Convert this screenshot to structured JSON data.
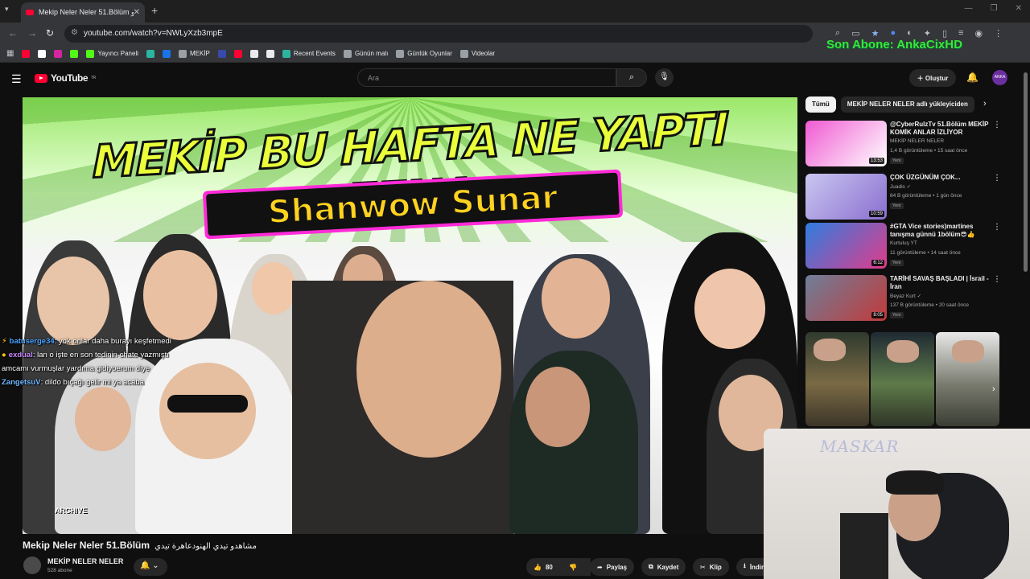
{
  "browser": {
    "tab_title": "Mekip Neler Neler 51.Bölüm مشاهدو",
    "tab_close": "✕",
    "new_tab": "+",
    "url": "youtube.com/watch?v=NWLyXzb3mpE",
    "bookmarks": [
      {
        "label": "",
        "color": "#ff0033"
      },
      {
        "label": "",
        "color": "#ffffff"
      },
      {
        "label": "",
        "color": "#d6249f"
      },
      {
        "label": "",
        "color": "#53fc18"
      },
      {
        "label": "Yayıncı Paneli",
        "color": "#53fc18"
      },
      {
        "label": "",
        "color": "#2bb5a0"
      },
      {
        "label": "",
        "color": "#1a73e8"
      },
      {
        "label": "MEKİP",
        "color": "#9aa0a6"
      },
      {
        "label": "",
        "color": "#3949ab"
      },
      {
        "label": "",
        "color": "#ff0033"
      },
      {
        "label": "",
        "color": "#e8eaed"
      },
      {
        "label": "",
        "color": "#e8eaed"
      },
      {
        "label": "Recent Events",
        "color": "#2bb5a0"
      },
      {
        "label": "Günün malı",
        "color": "#9aa0a6"
      },
      {
        "label": "Günlük Oyunlar",
        "color": "#9aa0a6"
      },
      {
        "label": "Videolar",
        "color": "#9aa0a6"
      }
    ]
  },
  "overlay": {
    "last_sub": "Son Abone: AnkaCixHD"
  },
  "youtube": {
    "logo_text": "YouTube",
    "logo_region": "TR",
    "search_placeholder": "Ara",
    "create_label": "Oluştur",
    "avatar_text": "ANKA"
  },
  "thumbnail": {
    "headline": "MEKİP BU HAFTA NE YAPTI FENA",
    "subheadline": "Shanwow Sunar",
    "watermark": "ARCHIVE"
  },
  "chat": [
    {
      "user": "batuserge34",
      "text": ": yok onlar daha burayı keşfetmedi",
      "color": "#4aa3ff",
      "badge": "⚡"
    },
    {
      "user": "exdual",
      "text": ": lan o işte en son tedinin chate yazmıştı",
      "color": "#c78bff",
      "badge": "●"
    },
    {
      "user": "",
      "text": "amcamı vurmuşlar yardıma gidiyoerum diye",
      "color": "#ffffff",
      "badge": ""
    },
    {
      "user": "ZangetsuV",
      "text": ": dildo bıçağı gelir mi ya acaba",
      "color": "#6fb7ff",
      "badge": ""
    }
  ],
  "webcam": {
    "name": "MASKAR"
  },
  "video": {
    "title": "Mekip Neler Neler 51.Bölüm",
    "title_ar": "مشاهدو تيدي الهنودعاهرة تيدي",
    "channel": "MEKİP NELER NELER",
    "subscribers": "528 abone",
    "likes": "80",
    "share": "Paylaş",
    "save": "Kaydet",
    "clip": "Klip",
    "download": "İndir"
  },
  "chips": [
    "Tümü",
    "MEKİP NELER NELER adlı yükleyiciden"
  ],
  "recommendations": [
    {
      "title": "@CyberRulzTv 51.Bölüm MEKİP KOMİK ANLAR İZLİYOR",
      "channel": "MEKİP NELER NELER",
      "meta": "1,4 B görüntüleme • 15 saat önce",
      "badge": "Yeni",
      "duration": "13:53",
      "thumb": [
        "#f05ad2",
        "#ffffff"
      ]
    },
    {
      "title": "ÇOK ÜZGÜNÜM ÇOK...",
      "channel": "Juadis ✓",
      "meta": "84 B görüntüleme • 1 gün önce",
      "badge": "Yeni",
      "duration": "10:59",
      "thumb": [
        "#c9c6f0",
        "#8a6fd0"
      ]
    },
    {
      "title": "#GTA Vice stories)martines tanışma günnü 1bölüm😎👍",
      "channel": "Kurtuluş YT",
      "meta": "11 görüntüleme • 14 saat önce",
      "badge": "Yeni",
      "duration": "6:12",
      "thumb": [
        "#2f7de0",
        "#e03c8a"
      ]
    },
    {
      "title": "TARİHİ SAVAŞ BAŞLADI | İsrail - İran",
      "channel": "Beyaz Kurt ✓",
      "meta": "137 B görüntüleme • 20 saat önce",
      "badge": "Yeni",
      "duration": "8:05",
      "thumb": [
        "#6e7f9a",
        "#c23a3a"
      ]
    }
  ]
}
